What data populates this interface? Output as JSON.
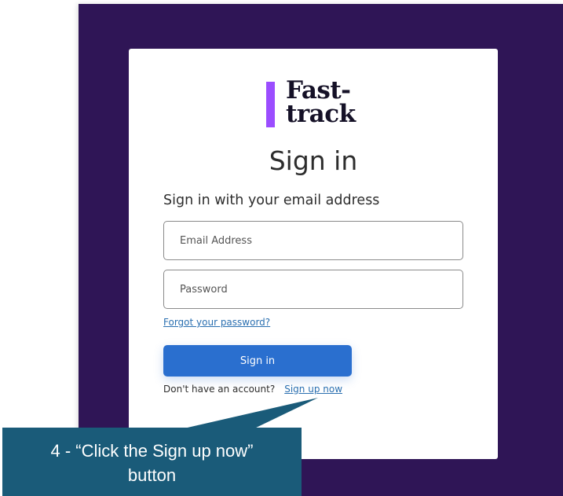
{
  "logo": {
    "line1": "Fast-",
    "line2": "track",
    "bar_color": "#9b4dff"
  },
  "heading": "Sign in",
  "subheading": "Sign in with your email address",
  "email": {
    "placeholder": "Email Address",
    "value": ""
  },
  "password": {
    "placeholder": "Password",
    "value": ""
  },
  "forgot_link": "Forgot your password?",
  "signin_button": "Sign in",
  "signup": {
    "prompt": "Don't have an account?",
    "link": "Sign up now"
  },
  "callout": {
    "line1": "4 - “Click the Sign up now”",
    "line2": "button"
  },
  "colors": {
    "backdrop": "#2f1556",
    "accent": "#2a6fcf",
    "callout": "#1a5b79"
  }
}
